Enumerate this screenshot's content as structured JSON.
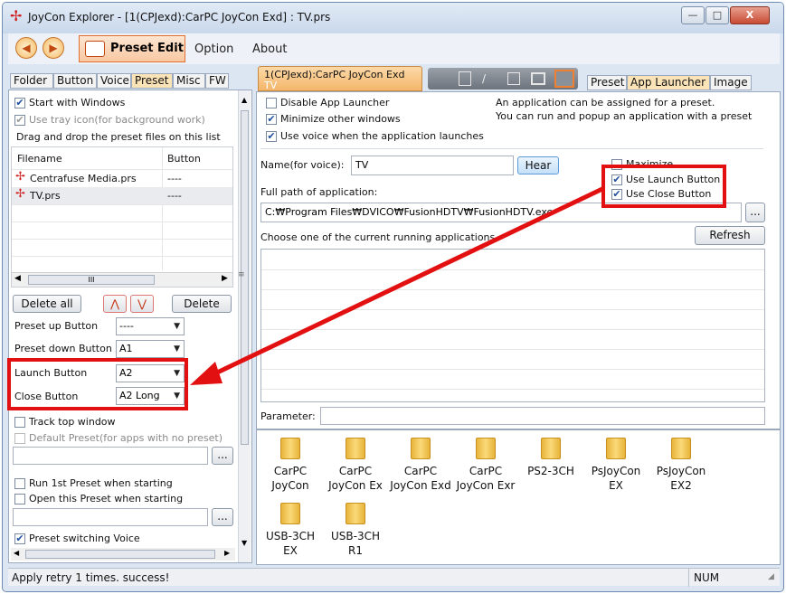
{
  "window": {
    "title": "JoyCon Explorer - [1(CPJexd):CarPC JoyCon Exd] : TV.prs",
    "controls": {
      "minimize": "—",
      "maximize": "□",
      "close": "X"
    }
  },
  "toolbar": {
    "back_icon": "◀",
    "forward_icon": "▶",
    "preset_edit_label": "Preset Edit",
    "option_label": "Option",
    "about_label": "About"
  },
  "left": {
    "tabs": [
      "Folder",
      "Button",
      "Voice",
      "Preset",
      "Misc",
      "FW"
    ],
    "start_with_windows": "Start with Windows",
    "use_tray_icon": "Use tray icon(for background work)",
    "drag_drop_hint": "Drag and drop the preset files on this list",
    "columns": {
      "filename": "Filename",
      "button": "Button"
    },
    "rows": [
      {
        "filename": "Centrafuse Media.prs",
        "button": "----"
      },
      {
        "filename": "TV.prs",
        "button": "----"
      }
    ],
    "delete_all": "Delete all",
    "up_icon": "⋀",
    "down_icon": "⋁",
    "delete": "Delete",
    "preset_up_label": "Preset up Button",
    "preset_up_value": "----",
    "preset_down_label": "Preset down Button",
    "preset_down_value": "A1",
    "launch_label": "Launch Button",
    "launch_value": "A2",
    "close_label": "Close Button",
    "close_value": "A2 Long",
    "track_top_window": "Track top window",
    "default_preset": "Default Preset(for apps with no preset)",
    "browse_label": "...",
    "run_first_preset": "Run 1st Preset when starting",
    "open_this_preset": "Open this Preset when starting",
    "browse2_label": "...",
    "preset_switching_voice": "Preset switching Voice",
    "scroll_thumb": "III"
  },
  "right": {
    "preset_tab_label": "1(CPJexd):CarPC JoyCon Exd",
    "preset_tab_sub": "TV",
    "subtabs": [
      "Preset",
      "App Launcher",
      "Image"
    ],
    "disable_app_launcher": "Disable App Launcher",
    "minimize_other_windows": "Minimize other windows",
    "use_voice_launch": "Use voice when the application launches",
    "info_line1": "An application can be assigned for a preset.",
    "info_line2": "You can run and popup an application with a preset",
    "name_label": "Name(for voice):",
    "name_value": "TV",
    "hear_label": "Hear",
    "maximize_label": "Maximize",
    "use_launch_button": "Use Launch Button",
    "use_close_button": "Use Close Button",
    "full_path_label": "Full path of application:",
    "full_path_value": "C:₩Program Files₩DVICO₩FusionHDTV₩FusionHDTV.exe",
    "browse_label": "...",
    "running_apps_label": "Choose one of the current running applications",
    "refresh_label": "Refresh",
    "parameter_label": "Parameter:",
    "parameter_value": "",
    "folders": [
      {
        "line1": "CarPC",
        "line2": "JoyCon"
      },
      {
        "line1": "CarPC",
        "line2": "JoyCon Ex"
      },
      {
        "line1": "CarPC",
        "line2": "JoyCon Exd"
      },
      {
        "line1": "CarPC",
        "line2": "JoyCon Exr"
      },
      {
        "line1": "PS2-3CH",
        "line2": ""
      },
      {
        "line1": "PsJoyCon",
        "line2": "EX"
      },
      {
        "line1": "PsJoyCon",
        "line2": "EX2"
      },
      {
        "line1": "USB-3CH",
        "line2": "EX"
      },
      {
        "line1": "USB-3CH",
        "line2": "R1"
      }
    ]
  },
  "status": {
    "message": "Apply retry  1 times. success!",
    "num": "NUM"
  },
  "colors": {
    "highlight": "#e21010",
    "selected_tab": "#fbe3b8",
    "accent": "#e07030"
  }
}
